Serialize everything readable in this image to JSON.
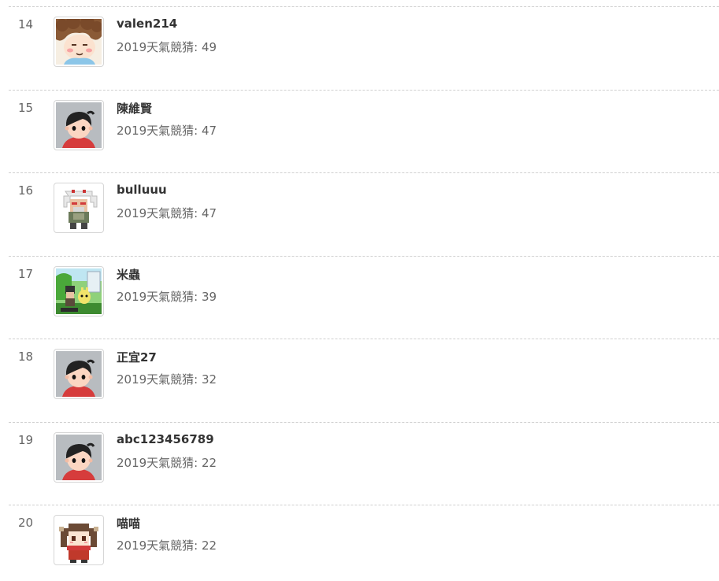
{
  "leaderboard": {
    "entries": [
      {
        "rank": "14",
        "username": "valen214",
        "score": "2019天氣競猜: 49",
        "avatar": "cartoon-brown-hair-avatar"
      },
      {
        "rank": "15",
        "username": "陳維賢",
        "score": "2019天氣競猜: 47",
        "avatar": "default-boy-avatar"
      },
      {
        "rank": "16",
        "username": "bulluuu",
        "score": "2019天氣競猜: 47",
        "avatar": "pixel-white-hair-warrior-avatar"
      },
      {
        "rank": "17",
        "username": "米蟲",
        "score": "2019天氣競猜: 39",
        "avatar": "pixel-game-scene-avatar"
      },
      {
        "rank": "18",
        "username": "正宜27",
        "score": "2019天氣競猜: 32",
        "avatar": "default-boy-avatar"
      },
      {
        "rank": "19",
        "username": "abc123456789",
        "score": "2019天氣競猜: 22",
        "avatar": "default-boy-avatar"
      },
      {
        "rank": "20",
        "username": "喵喵",
        "score": "2019天氣競猜: 22",
        "avatar": "pixel-twin-tail-girl-avatar"
      }
    ]
  }
}
